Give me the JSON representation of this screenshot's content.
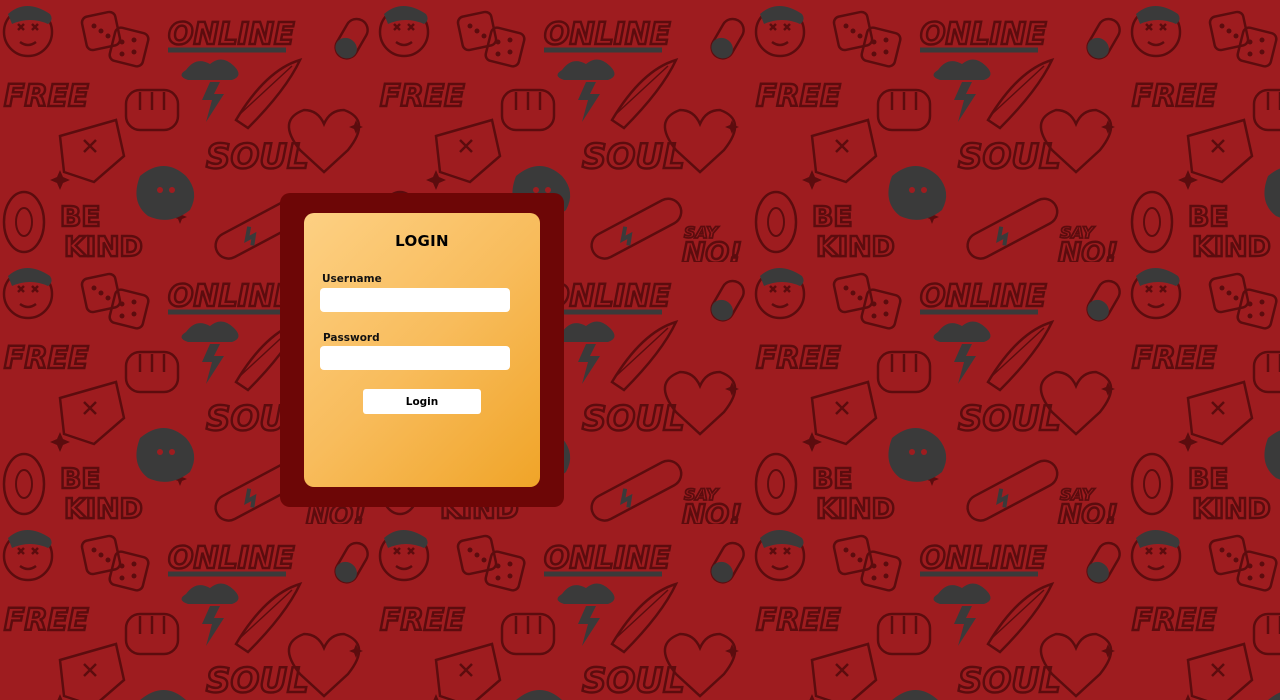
{
  "background": {
    "color": "#9e1c1f",
    "pattern_ink": "#3a3a3a",
    "pattern_line": "#6a1012",
    "doodle_words": [
      "ONLINE",
      "FREE",
      "SOUL",
      "BE KIND",
      "SAY NO!"
    ]
  },
  "login": {
    "title": "LOGIN",
    "username_label": "Username",
    "username_value": "",
    "password_label": "Password",
    "password_value": "",
    "button_label": "Login",
    "frame_color": "#6d0606",
    "card_gradient": [
      "#fdd083",
      "#f0a428"
    ]
  }
}
